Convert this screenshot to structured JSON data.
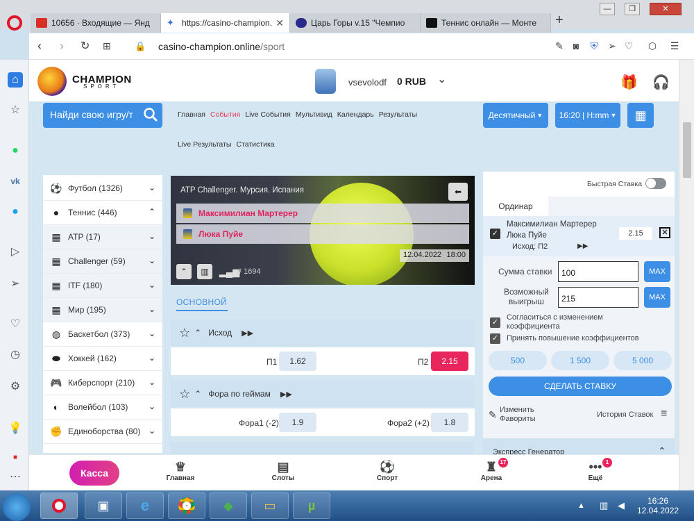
{
  "browser": {
    "tabs": [
      {
        "label": "10656 · Входящие — Янд",
        "icon_color": "#d93025"
      },
      {
        "label": "https://casino-champion.c",
        "icon_color": "#3a6ee8"
      },
      {
        "label": "Царь Горы v.15 \"Чемпио",
        "icon_color": "#2a2a8a"
      },
      {
        "label": "Теннис онлайн — Монте",
        "icon_color": "#111111"
      }
    ],
    "new_tab": "+",
    "url_domain": "casino-champion.online",
    "url_path": "/sport",
    "win_controls": [
      "—",
      "❐",
      "✕"
    ]
  },
  "site": {
    "brand": "CHAMPION",
    "brand_sub": "SPORT",
    "username": "vsevolodf",
    "balance": "0 RUB",
    "search_placeholder": "Найди свою игру/т",
    "menu": [
      "Главная",
      "События",
      "Live События",
      "Мультивид",
      "Календарь",
      "Результаты"
    ],
    "menu_row2": [
      "Live Результаты",
      "Статистика"
    ],
    "odds_format": "Десятичный",
    "time_format": "16:20 | H:mm"
  },
  "left_nav": [
    {
      "label": "Футбол (1326)",
      "icon": "football-icon",
      "glyph": "⚽",
      "chev": "⌄",
      "sub": false
    },
    {
      "label": "Теннис (446)",
      "icon": "tennis-icon",
      "glyph": "●",
      "chev": "⌃",
      "sub": false
    },
    {
      "label": "ATP (17)",
      "icon": "world-map-icon",
      "glyph": "▦",
      "chev": "⌄",
      "sub": true
    },
    {
      "label": "Challenger (59)",
      "icon": "world-map-icon",
      "glyph": "▦",
      "chev": "⌄",
      "sub": true
    },
    {
      "label": "ITF (180)",
      "icon": "world-map-icon",
      "glyph": "▦",
      "chev": "⌄",
      "sub": true
    },
    {
      "label": "Мир (195)",
      "icon": "world-map-icon",
      "glyph": "▦",
      "chev": "⌄",
      "sub": true
    },
    {
      "label": "Баскетбол (373)",
      "icon": "basketball-icon",
      "glyph": "◍",
      "chev": "⌄",
      "sub": false
    },
    {
      "label": "Хоккей (162)",
      "icon": "hockey-puck-icon",
      "glyph": "⬬",
      "chev": "⌄",
      "sub": false
    },
    {
      "label": "Киберспорт (210)",
      "icon": "gamepad-icon",
      "glyph": "🎮",
      "chev": "⌄",
      "sub": false
    },
    {
      "label": "Волейбол (103)",
      "icon": "volleyball-icon",
      "glyph": "◐",
      "chev": "⌄",
      "sub": false
    },
    {
      "label": "Единоборства (80)",
      "icon": "boxing-glove-icon",
      "glyph": "✊",
      "chev": "⌄",
      "sub": false
    }
  ],
  "event": {
    "tournament": "ATP Challenger. Мурсия. Испания",
    "team1": "Максимилиан Мартерер",
    "team2": "Люка Пуйе",
    "date": "12.04.2022",
    "time": "18:00",
    "event_id": "# 1694",
    "tab": "ОСНОВНОЙ"
  },
  "markets": [
    {
      "title": "Исход",
      "left_label": "П1",
      "left_odd": "1.62",
      "right_label": "П2",
      "right_odd": "2.15"
    },
    {
      "title": "Фора по геймам",
      "left_label": "Фора1 (-2)",
      "left_odd": "1.9",
      "right_label": "Фора2 (+2)",
      "right_odd": "1.8"
    }
  ],
  "betslip": {
    "quick_bet": "Быстрая Ставка",
    "tab": "Ординар",
    "team1": "Максимилиан Мартерер",
    "team2": "Люка Пуйе",
    "outcome": "Исход: П2",
    "odd": "2.15",
    "stake_label": "Сумма ставки",
    "stake_value": "100",
    "win_label_1": "Возможный",
    "win_label_2": "выигрыш",
    "win_value": "215",
    "max": "MAX",
    "agree_change": "Согласиться с изменением коэффициента",
    "accept_increase": "Принять повышение коэффициентов",
    "quick_amounts": [
      "500",
      "1 500",
      "5 000"
    ],
    "place_bet": "СДЕЛАТЬ СТАВКУ",
    "edit_fav_1": "Изменить",
    "edit_fav_2": "Фавориты",
    "history": "История Ставок",
    "express": "Экспресс Генератор"
  },
  "bottom_nav": {
    "kassa": "Касса",
    "items": [
      {
        "label": "Главная",
        "icon": "trophy-icon",
        "glyph": "♕",
        "badge": ""
      },
      {
        "label": "Слоты",
        "icon": "slot-machine-icon",
        "glyph": "▤",
        "badge": ""
      },
      {
        "label": "Спорт",
        "icon": "soccer-ball-icon",
        "glyph": "⚽",
        "badge": ""
      },
      {
        "label": "Арена",
        "icon": "arena-icon",
        "glyph": "♜",
        "badge": "17"
      },
      {
        "label": "Ещё",
        "icon": "more-icon",
        "glyph": "•••",
        "badge": "1"
      }
    ]
  },
  "taskbar": {
    "time": "16:26",
    "date": "12.04.2022"
  },
  "colors": {
    "accent": "#3d8fe6",
    "hot": "#e8255c",
    "brand_pink": "#d11fb0"
  }
}
